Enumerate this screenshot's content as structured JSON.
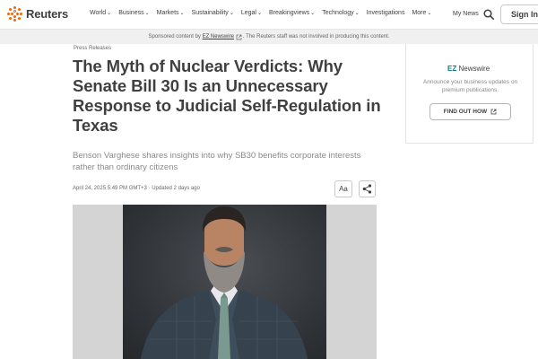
{
  "header": {
    "logo_text": "Reuters",
    "nav": [
      {
        "label": "World",
        "dropdown": true
      },
      {
        "label": "Business",
        "dropdown": true
      },
      {
        "label": "Markets",
        "dropdown": true
      },
      {
        "label": "Sustainability",
        "dropdown": true
      },
      {
        "label": "Legal",
        "dropdown": true
      },
      {
        "label": "Breakingviews",
        "dropdown": true
      },
      {
        "label": "Technology",
        "dropdown": true
      },
      {
        "label": "Investigations",
        "dropdown": false
      },
      {
        "label": "More",
        "dropdown": true
      }
    ],
    "my_news": "My News",
    "sign_in": "Sign In"
  },
  "sponsor_bar": {
    "prefix": "Sponsored content by ",
    "sponsor_name": "EZ Newswire",
    "suffix": ". The Reuters staff was not involved in producing this content."
  },
  "article": {
    "kicker": "Press Releases",
    "headline": "The Myth of Nuclear Verdicts: Why Senate Bill 30 Is an Unnecessary Response to Judicial Self-Regulation in Texas",
    "dek": "Benson Varghese shares insights into why SB30 benefits corporate interests rather than ordinary citizens",
    "dateline": "April 24, 2025 5:49 PM GMT+3 · Updated 2 days ago",
    "font_size_button": "Aa"
  },
  "sidebar_ad": {
    "brand_prefix": "EZ",
    "brand_name": "Newswire",
    "text": "Announce your business updates on premium publications.",
    "cta": "FIND OUT HOW"
  },
  "colors": {
    "brand_orange": "#fa6400",
    "text": "#404040",
    "ez_teal": "#0a7c86"
  }
}
